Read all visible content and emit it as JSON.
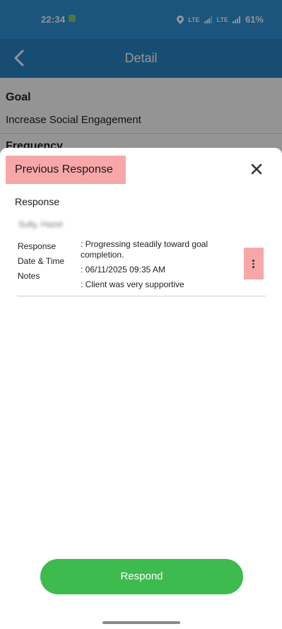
{
  "status_bar": {
    "time": "22:34",
    "notification_badge": "",
    "network_1": "LTE",
    "network_2": "LTE",
    "battery": "61%",
    "icons": [
      "location-icon",
      "signal-icon",
      "signal-icon",
      "battery-icon"
    ]
  },
  "header": {
    "title": "Detail",
    "back_icon": "chevron-left-icon",
    "color": "#2a86c6"
  },
  "background": {
    "goal_label": "Goal",
    "goal_value": "Increase Social Engagement",
    "frequency_label": "Frequency"
  },
  "sheet": {
    "title": "Previous Response",
    "close_icon": "close-icon",
    "section_label": "Response",
    "respondent_name": "Sully, Hazel",
    "fields": {
      "response_label": "Response",
      "datetime_label": "Date & Time",
      "notes_label": "Notes",
      "response_value": ": Progressing steadily toward goal completion.",
      "datetime_value": ": 06/11/2025 09:35 AM",
      "notes_value": ": Client was very supportive"
    },
    "more_icon": "more-vertical-icon",
    "highlight_color": "#f7a7a7"
  },
  "respond_button": {
    "label": "Respond",
    "color": "#3dbb4e"
  }
}
